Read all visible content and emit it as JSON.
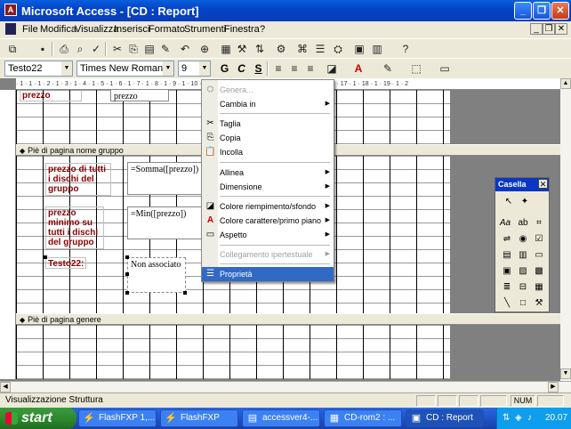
{
  "window": {
    "title": "Microsoft Access - [CD : Report]",
    "app_icon_letter": "A",
    "min": "_",
    "restore": "❐",
    "close": "✕"
  },
  "menubar": {
    "items": [
      "File",
      "Modifica",
      "Visualizza",
      "Inserisci",
      "Formato",
      "Strumenti",
      "Finestra",
      "?"
    ],
    "mdi_controls": [
      "_",
      "❐",
      "✕"
    ]
  },
  "format_toolbar": {
    "object_combo": "Testo22",
    "font_combo": "Times New Roman",
    "size_combo": "9",
    "bold": "G",
    "italic": "C",
    "underline": "S"
  },
  "ruler": {
    "labels": "· 1 · 1 · 1 · 2 · 1 · 3 · 1 · 4 · 1 · 5 · 1 · 6 · 1 · 7 · 1 · 8 · 1 · 9 · 1 · 10 · 1 · 11 · 1 · 12 · 1 · 13 · 1 · 14 · 1 · 15 · 1 · 16 · 1 · 17 · 1 · 18 · 1 · 19 · 1 · 2"
  },
  "design": {
    "top_label_1": "prezzo",
    "top_label_2": "prezzo",
    "group_footer_title": "Piè di pagina nome gruppo",
    "label_totale": "prezzo di tutti i dischi del gruppo",
    "field_somma": "=Somma([prezzo])",
    "label_minimo": "prezzo minimo su tutti i dischi del gruppo",
    "field_min": "=Min([prezzo])",
    "label_testo22": "Testo22:",
    "field_non_associato": "Non associato",
    "genere_footer_title": "Piè di pagina genere"
  },
  "context_menu": {
    "items": [
      {
        "label": "Genera...",
        "disabled": true,
        "icon": "⛭"
      },
      {
        "label": "Cambia in",
        "submenu": true
      },
      {
        "label": "Taglia",
        "icon": "✂"
      },
      {
        "label": "Copia",
        "icon": "⎘"
      },
      {
        "label": "Incolla",
        "icon": "📋"
      },
      {
        "label": "Allinea",
        "submenu": true
      },
      {
        "label": "Dimensione",
        "submenu": true
      },
      {
        "label": "Colore riempimento/sfondo",
        "submenu": true,
        "icon": "◪"
      },
      {
        "label": "Colore carattere/primo piano",
        "submenu": true,
        "icon": "A"
      },
      {
        "label": "Aspetto",
        "submenu": true,
        "icon": "▭"
      },
      {
        "label": "Collegamento ipertestuale",
        "submenu": true,
        "disabled": true
      },
      {
        "label": "Proprietà",
        "selected": true,
        "icon": "☰"
      }
    ]
  },
  "toolbox": {
    "title": "Casella",
    "close": "✕"
  },
  "statusbar": {
    "text": "Visualizzazione Struttura",
    "num": "NUM"
  },
  "taskbar": {
    "start": "start",
    "tasks": [
      "FlashFXP 1,...",
      "FlashFXP",
      "accessver4-...",
      "CD-rom2 : ...",
      "CD : Report"
    ],
    "clock": "20.07"
  }
}
